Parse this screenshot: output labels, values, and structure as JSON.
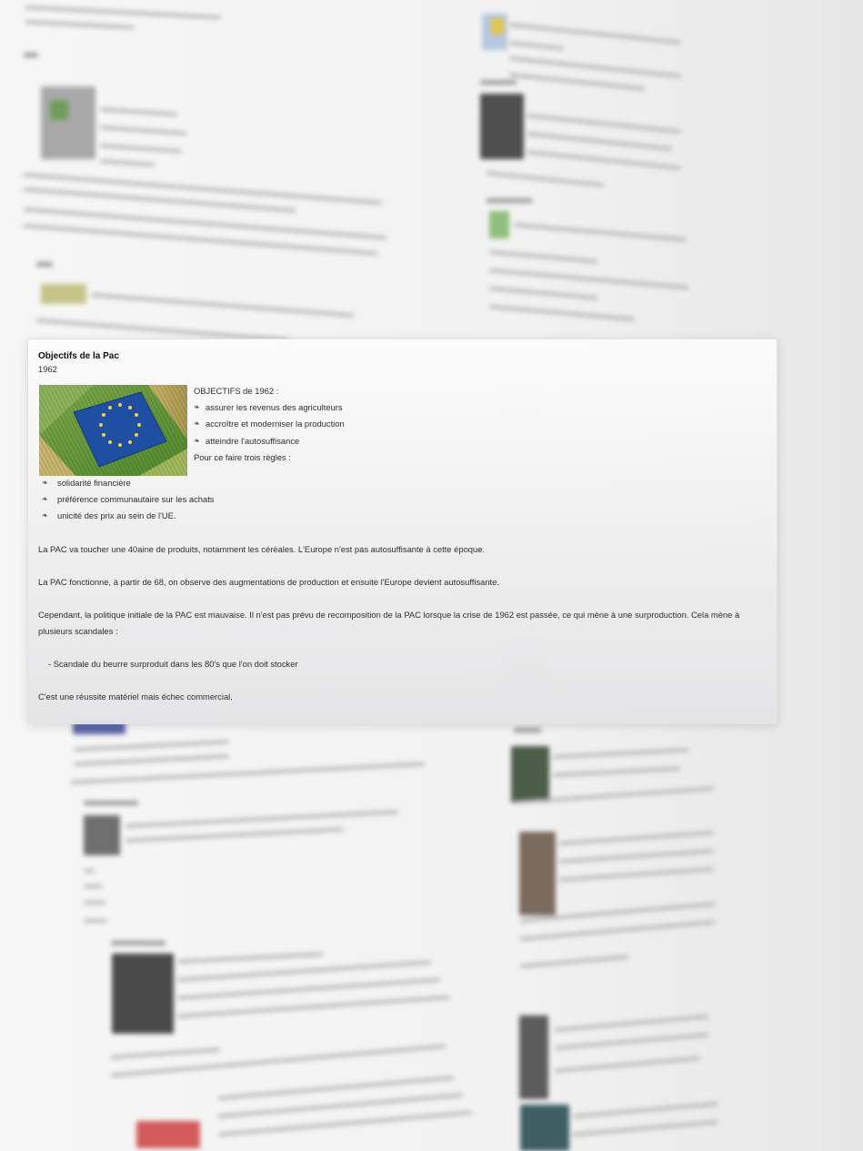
{
  "popup": {
    "title": "Objectifs de la Pac",
    "subtitle": "1962",
    "image_alt": "EU-flag crop field",
    "objectives_heading": "OBJECTIFS de 1962 :",
    "objectives": [
      "assurer les revenus des agriculteurs",
      "accroître et moderniser la production",
      "atteindre l'autosuffisance"
    ],
    "rules_heading": "Pour ce faire trois règles :",
    "rules": [
      "solidarité financière",
      "préférence communautaire sur les achats",
      "unicité des prix au sein de l'UE."
    ],
    "paragraphs": [
      "La PAC va toucher une 40aine de produits, notamment les céréales. L'Europe n'est pas autosuffisante à cette époque.",
      "La PAC fonctionne, à partir de 68, on observe des augmentations de production et ensuite l'Europe devient autosuffisante.",
      "Cependant, la politique initiale de la PAC est mauvaise. Il n'est pas prévu de recomposition de la PAC lorsque la crise de 1962 est passée, ce qui mène à une surproduction. Cela mène à plusieurs scandales :",
      "- Scandale du beurre surproduit dans les 80's que l'on doit stocker",
      "C'est une réussite matériel mais échec commercial."
    ],
    "bullet_glyph": "❧"
  },
  "colors": {
    "background": "#f2f2f2",
    "card": "#f6f6f7",
    "text": "#303030",
    "eu_blue": "#1f4fa3",
    "eu_star": "#f3d23a",
    "field_green": "#5f9a34"
  }
}
